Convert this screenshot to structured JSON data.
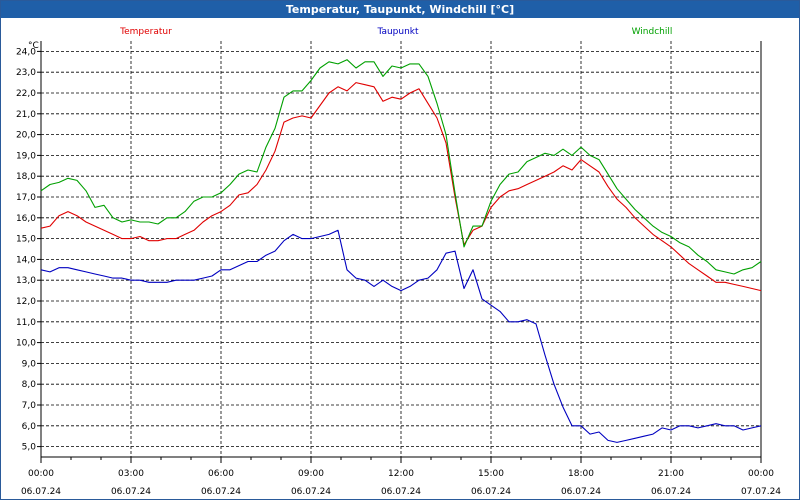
{
  "window": {
    "title": "Temperatur, Taupunkt, Windchill [°C]"
  },
  "chart_data": {
    "type": "line",
    "title": "Temperatur, Taupunkt, Windchill [°C]",
    "ylabel": "°C",
    "ylim": [
      4.5,
      24.5
    ],
    "yticks": [
      5.0,
      6.0,
      7.0,
      8.0,
      9.0,
      10.0,
      11.0,
      12.0,
      13.0,
      14.0,
      15.0,
      16.0,
      17.0,
      18.0,
      19.0,
      20.0,
      21.0,
      22.0,
      23.0,
      24.0
    ],
    "ytick_labels": [
      "5,0",
      "6,0",
      "7,0",
      "8,0",
      "9,0",
      "10,0",
      "11,0",
      "12,0",
      "13,0",
      "14,0",
      "15,0",
      "16,0",
      "17,0",
      "18,0",
      "19,0",
      "20,0",
      "21,0",
      "22,0",
      "23,0",
      "24,0"
    ],
    "xlim": [
      0,
      24
    ],
    "xticks": [
      0,
      3,
      6,
      9,
      12,
      15,
      18,
      21,
      24
    ],
    "xtick_time_labels": [
      "00:00",
      "03:00",
      "06:00",
      "09:00",
      "12:00",
      "15:00",
      "18:00",
      "21:00",
      "00:00"
    ],
    "xtick_date_labels": [
      "06.07.24",
      "06.07.24",
      "06.07.24",
      "06.07.24",
      "06.07.24",
      "06.07.24",
      "06.07.24",
      "06.07.24",
      "07.07.24"
    ],
    "grid": true,
    "legend_position": "top",
    "series": [
      {
        "name": "Temperatur",
        "color": "#e00000",
        "x": [
          0,
          0.3,
          0.6,
          0.9,
          1.2,
          1.5,
          1.8,
          2.1,
          2.4,
          2.7,
          3.0,
          3.3,
          3.6,
          3.9,
          4.2,
          4.5,
          4.8,
          5.1,
          5.4,
          5.7,
          6.0,
          6.3,
          6.6,
          6.9,
          7.2,
          7.5,
          7.8,
          8.1,
          8.4,
          8.7,
          9.0,
          9.3,
          9.6,
          9.9,
          10.2,
          10.5,
          10.8,
          11.1,
          11.4,
          11.7,
          12.0,
          12.3,
          12.6,
          12.9,
          13.2,
          13.5,
          13.8,
          14.1,
          14.4,
          14.7,
          15.0,
          15.3,
          15.6,
          15.9,
          16.2,
          16.5,
          16.8,
          17.1,
          17.4,
          17.7,
          18.0,
          18.3,
          18.6,
          18.9,
          19.2,
          19.5,
          19.8,
          20.1,
          20.4,
          20.7,
          21.0,
          21.3,
          21.6,
          21.9,
          22.2,
          22.5,
          22.8,
          23.1,
          23.4,
          23.7,
          24.0
        ],
        "values": [
          15.5,
          15.6,
          16.1,
          16.3,
          16.1,
          15.8,
          15.6,
          15.4,
          15.2,
          15.0,
          15.0,
          15.1,
          14.9,
          14.9,
          15.0,
          15.0,
          15.2,
          15.4,
          15.8,
          16.1,
          16.3,
          16.6,
          17.1,
          17.2,
          17.6,
          18.3,
          19.2,
          20.6,
          20.8,
          20.9,
          20.8,
          21.4,
          22.0,
          22.3,
          22.1,
          22.5,
          22.4,
          22.3,
          21.6,
          21.8,
          21.7,
          22.0,
          22.2,
          21.5,
          20.8,
          19.6,
          17.0,
          14.7,
          15.4,
          15.6,
          16.5,
          17.0,
          17.3,
          17.4,
          17.6,
          17.8,
          18.0,
          18.2,
          18.5,
          18.3,
          18.8,
          18.5,
          18.2,
          17.5,
          16.9,
          16.5,
          16.0,
          15.6,
          15.2,
          14.9,
          14.6,
          14.2,
          13.8,
          13.5,
          13.2,
          12.9,
          12.9,
          12.8,
          12.7,
          12.6,
          12.5
        ]
      },
      {
        "name": "Taupunkt",
        "color": "#0000c0",
        "x": [
          0,
          0.3,
          0.6,
          0.9,
          1.2,
          1.5,
          1.8,
          2.1,
          2.4,
          2.7,
          3.0,
          3.3,
          3.6,
          3.9,
          4.2,
          4.5,
          4.8,
          5.1,
          5.4,
          5.7,
          6.0,
          6.3,
          6.6,
          6.9,
          7.2,
          7.5,
          7.8,
          8.1,
          8.4,
          8.7,
          9.0,
          9.3,
          9.6,
          9.9,
          10.2,
          10.5,
          10.8,
          11.1,
          11.4,
          11.7,
          12.0,
          12.3,
          12.6,
          12.9,
          13.2,
          13.5,
          13.8,
          14.1,
          14.4,
          14.7,
          15.0,
          15.3,
          15.6,
          15.9,
          16.2,
          16.5,
          16.8,
          17.1,
          17.4,
          17.7,
          18.0,
          18.3,
          18.6,
          18.9,
          19.2,
          19.5,
          19.8,
          20.1,
          20.4,
          20.7,
          21.0,
          21.3,
          21.6,
          21.9,
          22.2,
          22.5,
          22.8,
          23.1,
          23.4,
          23.7,
          24.0
        ],
        "values": [
          13.5,
          13.4,
          13.6,
          13.6,
          13.5,
          13.4,
          13.3,
          13.2,
          13.1,
          13.1,
          13.0,
          13.0,
          12.9,
          12.9,
          12.9,
          13.0,
          13.0,
          13.0,
          13.1,
          13.2,
          13.5,
          13.5,
          13.7,
          13.9,
          13.9,
          14.2,
          14.4,
          14.9,
          15.2,
          15.0,
          15.0,
          15.1,
          15.2,
          15.4,
          13.5,
          13.1,
          13.0,
          12.7,
          13.0,
          12.7,
          12.5,
          12.7,
          13.0,
          13.1,
          13.5,
          14.3,
          14.4,
          12.6,
          13.5,
          12.1,
          11.8,
          11.5,
          11.0,
          11.0,
          11.1,
          10.9,
          9.4,
          8.0,
          6.9,
          6.0,
          6.0,
          5.6,
          5.7,
          5.3,
          5.2,
          5.3,
          5.4,
          5.5,
          5.6,
          5.9,
          5.8,
          6.0,
          6.0,
          5.9,
          6.0,
          6.1,
          6.0,
          6.0,
          5.8,
          5.9,
          6.0
        ]
      },
      {
        "name": "Windchill",
        "color": "#00a000",
        "x": [
          0,
          0.3,
          0.6,
          0.9,
          1.2,
          1.5,
          1.8,
          2.1,
          2.4,
          2.7,
          3.0,
          3.3,
          3.6,
          3.9,
          4.2,
          4.5,
          4.8,
          5.1,
          5.4,
          5.7,
          6.0,
          6.3,
          6.6,
          6.9,
          7.2,
          7.5,
          7.8,
          8.1,
          8.4,
          8.7,
          9.0,
          9.3,
          9.6,
          9.9,
          10.2,
          10.5,
          10.8,
          11.1,
          11.4,
          11.7,
          12.0,
          12.3,
          12.6,
          12.9,
          13.2,
          13.5,
          13.8,
          14.1,
          14.4,
          14.7,
          15.0,
          15.3,
          15.6,
          15.9,
          16.2,
          16.5,
          16.8,
          17.1,
          17.4,
          17.7,
          18.0,
          18.3,
          18.6,
          18.9,
          19.2,
          19.5,
          19.8,
          20.1,
          20.4,
          20.7,
          21.0,
          21.3,
          21.6,
          21.9,
          22.2,
          22.5,
          22.8,
          23.1,
          23.4,
          23.7,
          24.0
        ],
        "values": [
          17.3,
          17.6,
          17.7,
          17.9,
          17.8,
          17.3,
          16.5,
          16.6,
          16.0,
          15.8,
          15.9,
          15.8,
          15.8,
          15.7,
          16.0,
          16.0,
          16.3,
          16.8,
          17.0,
          17.0,
          17.2,
          17.6,
          18.1,
          18.3,
          18.2,
          19.4,
          20.3,
          21.8,
          22.1,
          22.1,
          22.6,
          23.2,
          23.5,
          23.4,
          23.6,
          23.2,
          23.5,
          23.5,
          22.8,
          23.3,
          23.2,
          23.4,
          23.4,
          22.8,
          21.5,
          20.0,
          17.2,
          14.6,
          15.6,
          15.6,
          16.8,
          17.6,
          18.1,
          18.2,
          18.7,
          18.9,
          19.1,
          19.0,
          19.3,
          19.0,
          19.4,
          19.0,
          18.8,
          18.1,
          17.4,
          16.9,
          16.4,
          16.0,
          15.6,
          15.3,
          15.1,
          14.8,
          14.6,
          14.2,
          13.9,
          13.5,
          13.4,
          13.3,
          13.5,
          13.6,
          13.9
        ]
      }
    ]
  }
}
